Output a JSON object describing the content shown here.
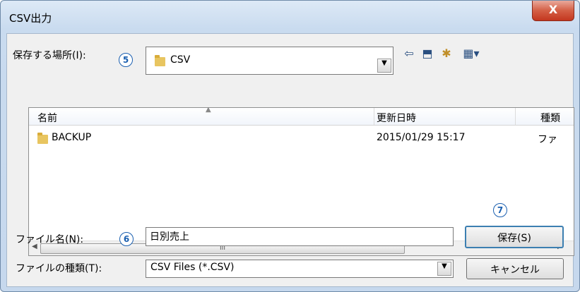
{
  "window": {
    "title": "CSV出力",
    "close_glyph": "X"
  },
  "save_in": {
    "label": "保存する場所(I):",
    "annotation": "5",
    "folder": "CSV",
    "drop_glyph": "▼"
  },
  "toolbar": {
    "back_glyph": "⇦",
    "up_glyph": "⬒",
    "new_folder_glyph": "✱",
    "view_glyph": "▦▾"
  },
  "list": {
    "columns": [
      "名前",
      "更新日時",
      "種類"
    ],
    "rows": [
      {
        "name": "BACKUP",
        "modified": "2015/01/29 15:17",
        "type": "ファ"
      }
    ],
    "scroll_grip": "III",
    "scroll_left": "◀",
    "scroll_right": "▶"
  },
  "filename": {
    "label": "ファイル名(N):",
    "annotation": "6",
    "value": "日別売上"
  },
  "filetype": {
    "label": "ファイルの種類(T):",
    "value": "CSV Files (*.CSV)",
    "drop_glyph": "▼"
  },
  "buttons": {
    "save": "保存(S)",
    "save_annotation": "7",
    "cancel": "キャンセル"
  }
}
